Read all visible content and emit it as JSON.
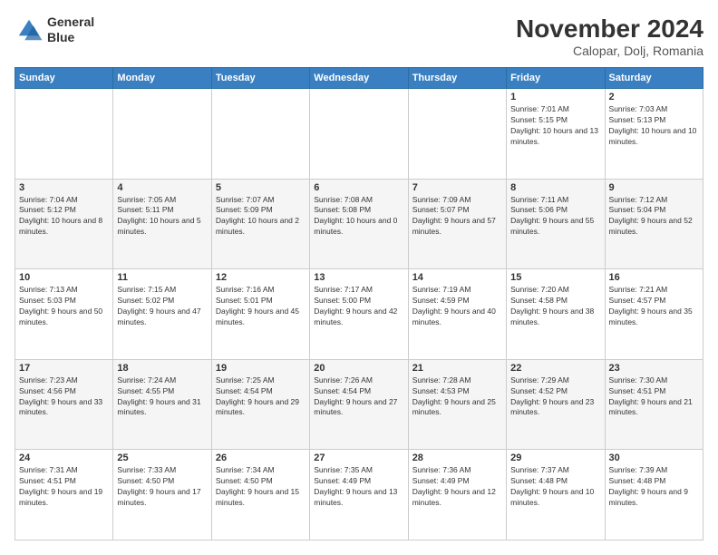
{
  "header": {
    "logo_line1": "General",
    "logo_line2": "Blue",
    "month": "November 2024",
    "location": "Calopar, Dolj, Romania"
  },
  "days_of_week": [
    "Sunday",
    "Monday",
    "Tuesday",
    "Wednesday",
    "Thursday",
    "Friday",
    "Saturday"
  ],
  "weeks": [
    [
      {
        "day": "",
        "info": ""
      },
      {
        "day": "",
        "info": ""
      },
      {
        "day": "",
        "info": ""
      },
      {
        "day": "",
        "info": ""
      },
      {
        "day": "",
        "info": ""
      },
      {
        "day": "1",
        "info": "Sunrise: 7:01 AM\nSunset: 5:15 PM\nDaylight: 10 hours and 13 minutes."
      },
      {
        "day": "2",
        "info": "Sunrise: 7:03 AM\nSunset: 5:13 PM\nDaylight: 10 hours and 10 minutes."
      }
    ],
    [
      {
        "day": "3",
        "info": "Sunrise: 7:04 AM\nSunset: 5:12 PM\nDaylight: 10 hours and 8 minutes."
      },
      {
        "day": "4",
        "info": "Sunrise: 7:05 AM\nSunset: 5:11 PM\nDaylight: 10 hours and 5 minutes."
      },
      {
        "day": "5",
        "info": "Sunrise: 7:07 AM\nSunset: 5:09 PM\nDaylight: 10 hours and 2 minutes."
      },
      {
        "day": "6",
        "info": "Sunrise: 7:08 AM\nSunset: 5:08 PM\nDaylight: 10 hours and 0 minutes."
      },
      {
        "day": "7",
        "info": "Sunrise: 7:09 AM\nSunset: 5:07 PM\nDaylight: 9 hours and 57 minutes."
      },
      {
        "day": "8",
        "info": "Sunrise: 7:11 AM\nSunset: 5:06 PM\nDaylight: 9 hours and 55 minutes."
      },
      {
        "day": "9",
        "info": "Sunrise: 7:12 AM\nSunset: 5:04 PM\nDaylight: 9 hours and 52 minutes."
      }
    ],
    [
      {
        "day": "10",
        "info": "Sunrise: 7:13 AM\nSunset: 5:03 PM\nDaylight: 9 hours and 50 minutes."
      },
      {
        "day": "11",
        "info": "Sunrise: 7:15 AM\nSunset: 5:02 PM\nDaylight: 9 hours and 47 minutes."
      },
      {
        "day": "12",
        "info": "Sunrise: 7:16 AM\nSunset: 5:01 PM\nDaylight: 9 hours and 45 minutes."
      },
      {
        "day": "13",
        "info": "Sunrise: 7:17 AM\nSunset: 5:00 PM\nDaylight: 9 hours and 42 minutes."
      },
      {
        "day": "14",
        "info": "Sunrise: 7:19 AM\nSunset: 4:59 PM\nDaylight: 9 hours and 40 minutes."
      },
      {
        "day": "15",
        "info": "Sunrise: 7:20 AM\nSunset: 4:58 PM\nDaylight: 9 hours and 38 minutes."
      },
      {
        "day": "16",
        "info": "Sunrise: 7:21 AM\nSunset: 4:57 PM\nDaylight: 9 hours and 35 minutes."
      }
    ],
    [
      {
        "day": "17",
        "info": "Sunrise: 7:23 AM\nSunset: 4:56 PM\nDaylight: 9 hours and 33 minutes."
      },
      {
        "day": "18",
        "info": "Sunrise: 7:24 AM\nSunset: 4:55 PM\nDaylight: 9 hours and 31 minutes."
      },
      {
        "day": "19",
        "info": "Sunrise: 7:25 AM\nSunset: 4:54 PM\nDaylight: 9 hours and 29 minutes."
      },
      {
        "day": "20",
        "info": "Sunrise: 7:26 AM\nSunset: 4:54 PM\nDaylight: 9 hours and 27 minutes."
      },
      {
        "day": "21",
        "info": "Sunrise: 7:28 AM\nSunset: 4:53 PM\nDaylight: 9 hours and 25 minutes."
      },
      {
        "day": "22",
        "info": "Sunrise: 7:29 AM\nSunset: 4:52 PM\nDaylight: 9 hours and 23 minutes."
      },
      {
        "day": "23",
        "info": "Sunrise: 7:30 AM\nSunset: 4:51 PM\nDaylight: 9 hours and 21 minutes."
      }
    ],
    [
      {
        "day": "24",
        "info": "Sunrise: 7:31 AM\nSunset: 4:51 PM\nDaylight: 9 hours and 19 minutes."
      },
      {
        "day": "25",
        "info": "Sunrise: 7:33 AM\nSunset: 4:50 PM\nDaylight: 9 hours and 17 minutes."
      },
      {
        "day": "26",
        "info": "Sunrise: 7:34 AM\nSunset: 4:50 PM\nDaylight: 9 hours and 15 minutes."
      },
      {
        "day": "27",
        "info": "Sunrise: 7:35 AM\nSunset: 4:49 PM\nDaylight: 9 hours and 13 minutes."
      },
      {
        "day": "28",
        "info": "Sunrise: 7:36 AM\nSunset: 4:49 PM\nDaylight: 9 hours and 12 minutes."
      },
      {
        "day": "29",
        "info": "Sunrise: 7:37 AM\nSunset: 4:48 PM\nDaylight: 9 hours and 10 minutes."
      },
      {
        "day": "30",
        "info": "Sunrise: 7:39 AM\nSunset: 4:48 PM\nDaylight: 9 hours and 9 minutes."
      }
    ]
  ]
}
